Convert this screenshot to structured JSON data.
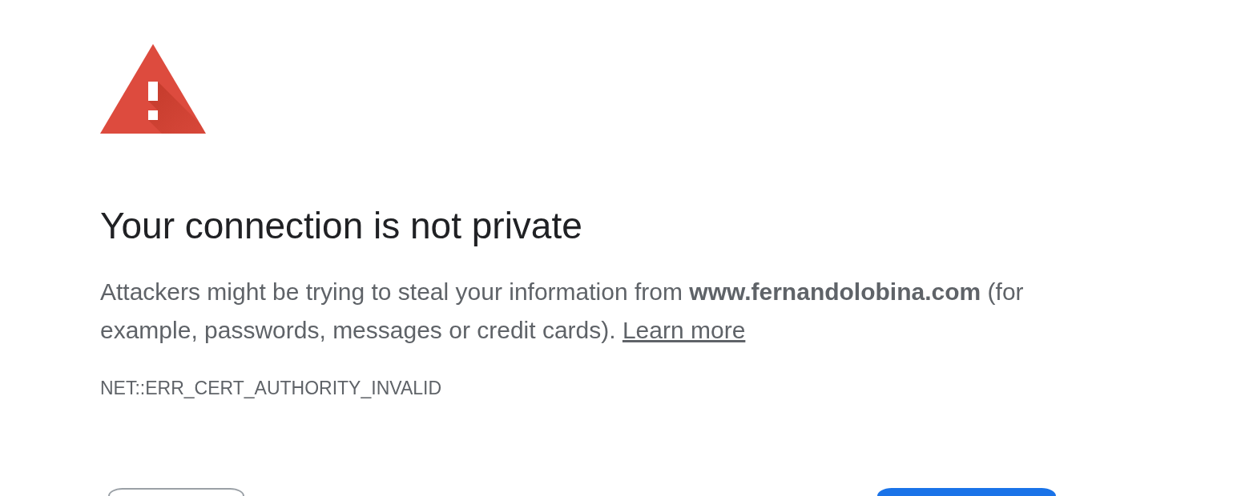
{
  "heading": "Your connection is not private",
  "message": {
    "text": "Attackers might be trying to steal your information from **www.fernandolobina.com** (for example, passwords, messages or credit cards).",
    "link": "Learn more"
  },
  "error_code": "NET::ERR_CERT_AUTHORITY_INVALID",
  "buttons": [
    {
      "kind": "secondary"
    },
    {
      "kind": "primary"
    }
  ]
}
